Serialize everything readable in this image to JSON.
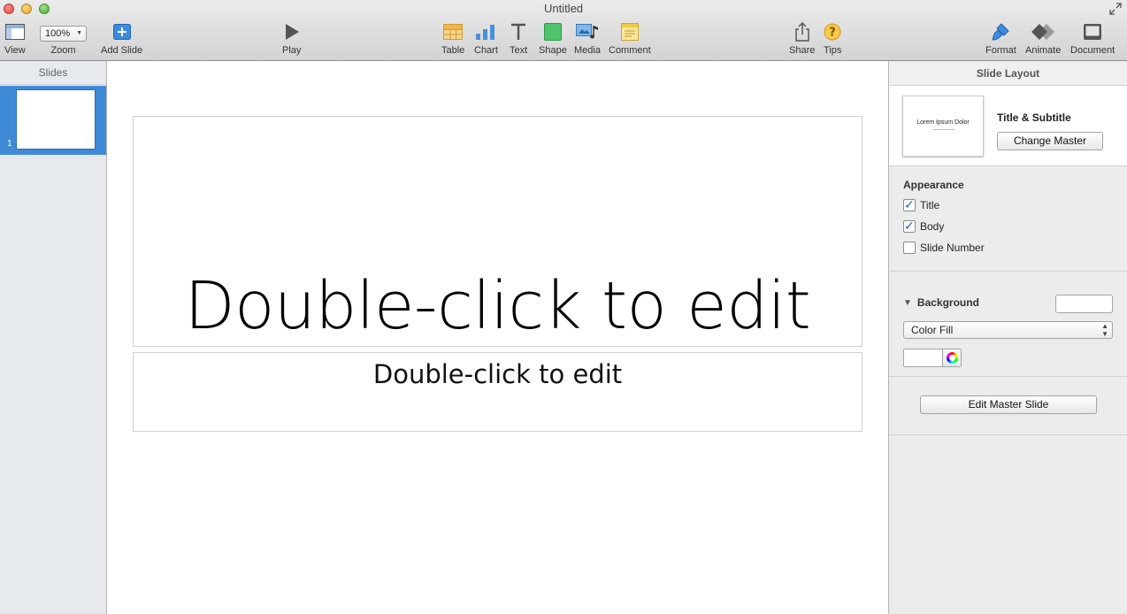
{
  "window": {
    "title": "Untitled"
  },
  "toolbar": {
    "view_label": "View",
    "zoom_value": "100%",
    "zoom_label": "Zoom",
    "add_slide_label": "Add Slide",
    "play_label": "Play",
    "table_label": "Table",
    "chart_label": "Chart",
    "text_label": "Text",
    "shape_label": "Shape",
    "media_label": "Media",
    "comment_label": "Comment",
    "share_label": "Share",
    "tips_label": "Tips",
    "format_label": "Format",
    "animate_label": "Animate",
    "document_label": "Document"
  },
  "navigator": {
    "header": "Slides",
    "slides": [
      {
        "number": "1"
      }
    ]
  },
  "slide": {
    "title_placeholder": "Double-click to edit",
    "subtitle_placeholder": "Double-click to edit"
  },
  "inspector": {
    "header": "Slide Layout",
    "master": {
      "thumb_text": "Lorem Ipsum Dolor",
      "name": "Title & Subtitle",
      "change_button": "Change Master"
    },
    "appearance": {
      "title": "Appearance",
      "options": [
        {
          "label": "Title",
          "checked": true
        },
        {
          "label": "Body",
          "checked": true
        },
        {
          "label": "Slide Number",
          "checked": false
        }
      ]
    },
    "background": {
      "title": "Background",
      "fill_type": "Color Fill",
      "color": "#ffffff"
    },
    "edit_master_button": "Edit Master Slide"
  },
  "colors": {
    "selection_blue": "#3f8ad6",
    "navigator_bg": "#e6e9ee",
    "inspector_bg": "#ececec"
  }
}
